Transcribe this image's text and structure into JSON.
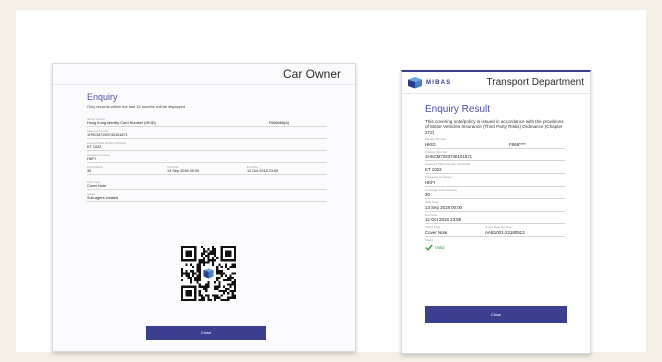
{
  "car_owner": {
    "title": "Car Owner",
    "heading": "Enquiry",
    "subtitle": "Only records within the last 12 months will be displayed",
    "fields": [
      {
        "label": "Identity Number",
        "value": "Hong Kong Identity Card Number (HKID)",
        "value_right": "F666666(A)"
      },
      {
        "label": "Document Number",
        "value": "1HSCM7263740101871"
      },
      {
        "label": "Licensed Plate Number (Optional)",
        "value": "KT 1022"
      },
      {
        "label": "Insurance Company",
        "value": "HKFI"
      }
    ],
    "row": [
      {
        "label": "Period (Days)",
        "value": "30"
      },
      {
        "label": "Start Date",
        "value": "13 Sep 2018 00:00"
      },
      {
        "label": "End Date",
        "value": "12 Oct 2018 23:59"
      }
    ],
    "policy_type": {
      "label": "Policy Type",
      "value": "Cover Note"
    },
    "issued": {
      "label": "Issued",
      "value": "Sub-agent created"
    },
    "close_label": "Close"
  },
  "transport": {
    "logo_text": "MIBAS",
    "title": "Transport Department",
    "heading": "Enquiry Result",
    "note": "This covering note/policy is issued in accordance with the provisions of Motor Vehicles Insurance (Third Party Risks) Ordinance (Chapter 272)",
    "identity": {
      "label": "Identity Number",
      "value": "HKID",
      "value_right": "F666****"
    },
    "fields": [
      {
        "label": "Chassis Number",
        "value": "1HSCM7263740101871"
      },
      {
        "label": "Licensed Plate Number (Optional)",
        "value": "KT 1022"
      },
      {
        "label": "Insurance Company",
        "value": "HKFI"
      },
      {
        "label": "Coverage Period (Days)",
        "value": "30"
      },
      {
        "label": "Start Date",
        "value": "13 Sep 2018 00:00"
      },
      {
        "label": "End Date",
        "value": "12 Oct 2018 23:59"
      }
    ],
    "row": [
      {
        "label": "Policy Type",
        "value": "Cover Note"
      },
      {
        "label": "Cover Note Number",
        "value": "AAB1001-22180913"
      }
    ],
    "status": {
      "label": "Status",
      "value": "Valid"
    },
    "close_label": "Close"
  },
  "colors": {
    "accent": "#3c3f8f",
    "heading": "#4a4fa8",
    "valid": "#43a047",
    "background": "#f4efe6"
  }
}
